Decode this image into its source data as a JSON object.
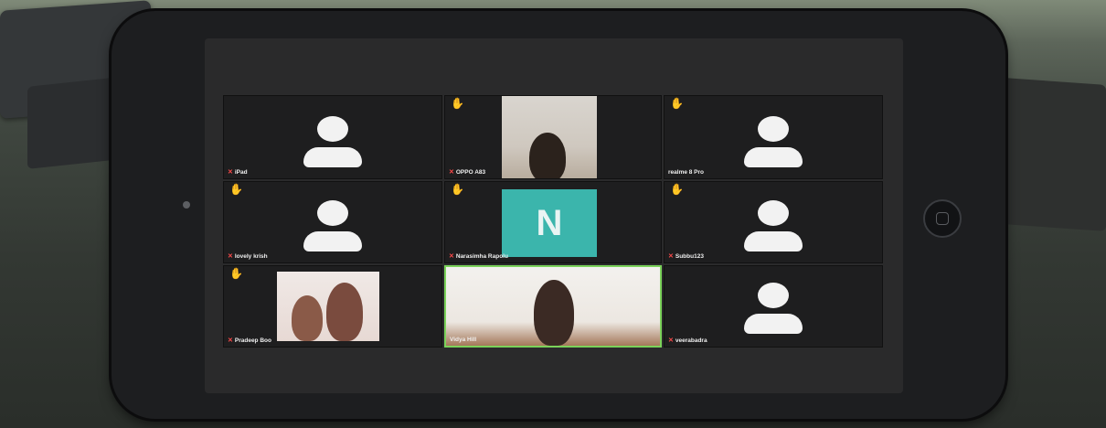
{
  "participants": [
    {
      "name": "iPad",
      "hand_raised": false,
      "video": "avatar"
    },
    {
      "name": "OPPO A83",
      "hand_raised": true,
      "video": "camera"
    },
    {
      "name": "realme 8 Pro",
      "hand_raised": true,
      "video": "avatar"
    },
    {
      "name": "lovely krish",
      "hand_raised": true,
      "video": "avatar"
    },
    {
      "name": "Narasimha Rapolu",
      "hand_raised": true,
      "video": "initial",
      "initial": "N"
    },
    {
      "name": "Subbu123",
      "hand_raised": true,
      "video": "avatar"
    },
    {
      "name": "Pradeep Boo",
      "hand_raised": true,
      "video": "camera"
    },
    {
      "name": "Vidya Hill",
      "hand_raised": false,
      "video": "camera",
      "active_speaker": true
    },
    {
      "name": "veerabadra",
      "hand_raised": false,
      "video": "avatar"
    }
  ],
  "icons": {
    "hand": "raised-hand-icon",
    "mic": "muted-mic-icon"
  },
  "colors": {
    "initial_tile": "#3bb5ac",
    "active_border": "#7bd25a",
    "raised_hand": "#e7b93b",
    "muted_mic": "#ff4a4a"
  }
}
